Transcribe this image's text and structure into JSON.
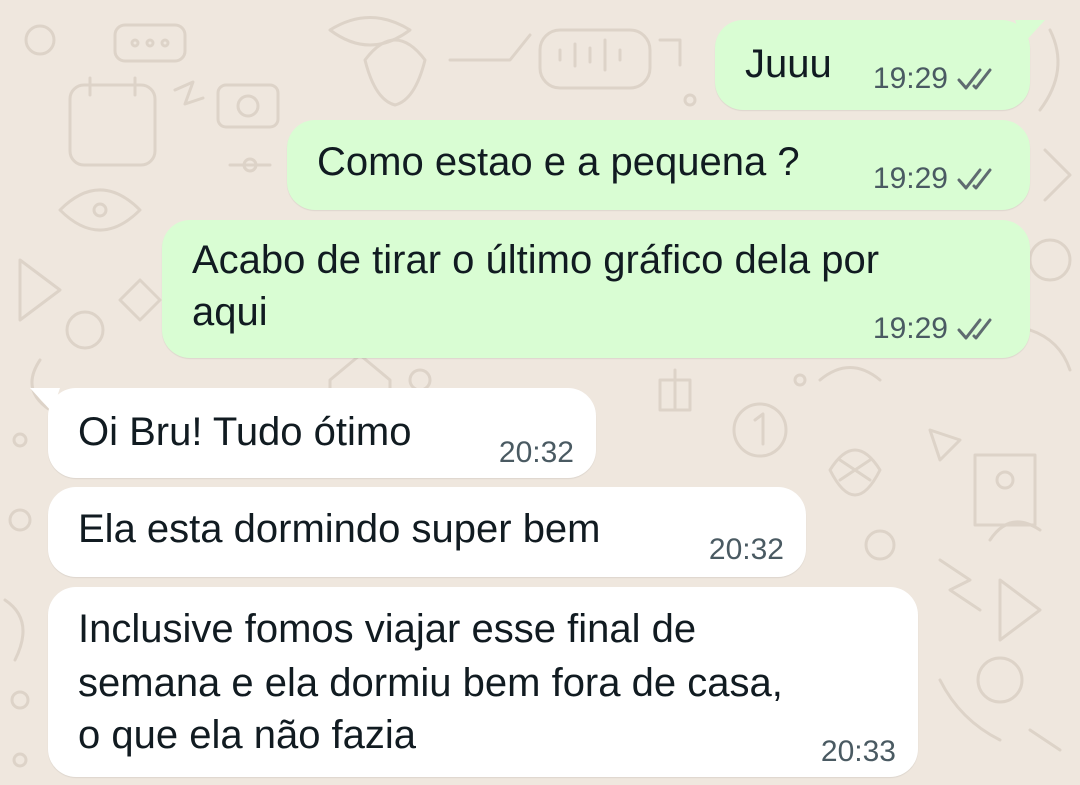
{
  "chat": {
    "messages": [
      {
        "direction": "outgoing",
        "text": "Juuu",
        "time": "19:29",
        "status_icon": "double-check-icon"
      },
      {
        "direction": "outgoing",
        "text": "Como estao e a pequena ?",
        "time": "19:29",
        "status_icon": "double-check-icon"
      },
      {
        "direction": "outgoing",
        "lines": [
          "Acabo de tirar o último gráfico dela por",
          "aqui"
        ],
        "time": "19:29",
        "status_icon": "double-check-icon"
      },
      {
        "direction": "incoming",
        "text": "Oi Bru! Tudo ótimo",
        "time": "20:32"
      },
      {
        "direction": "incoming",
        "text": "Ela esta dormindo super bem",
        "time": "20:32"
      },
      {
        "direction": "incoming",
        "lines": [
          "Inclusive fomos viajar esse final de",
          "semana e ela dormiu bem fora de casa,",
          "o que ela não fazia"
        ],
        "time": "20:33"
      }
    ]
  },
  "colors": {
    "wallpaper": "#efe7de",
    "outgoing_bubble": "#d9fdd3",
    "incoming_bubble": "#ffffff",
    "timestamp": "#4a5a62",
    "tick_gray": "#5f6b70"
  }
}
